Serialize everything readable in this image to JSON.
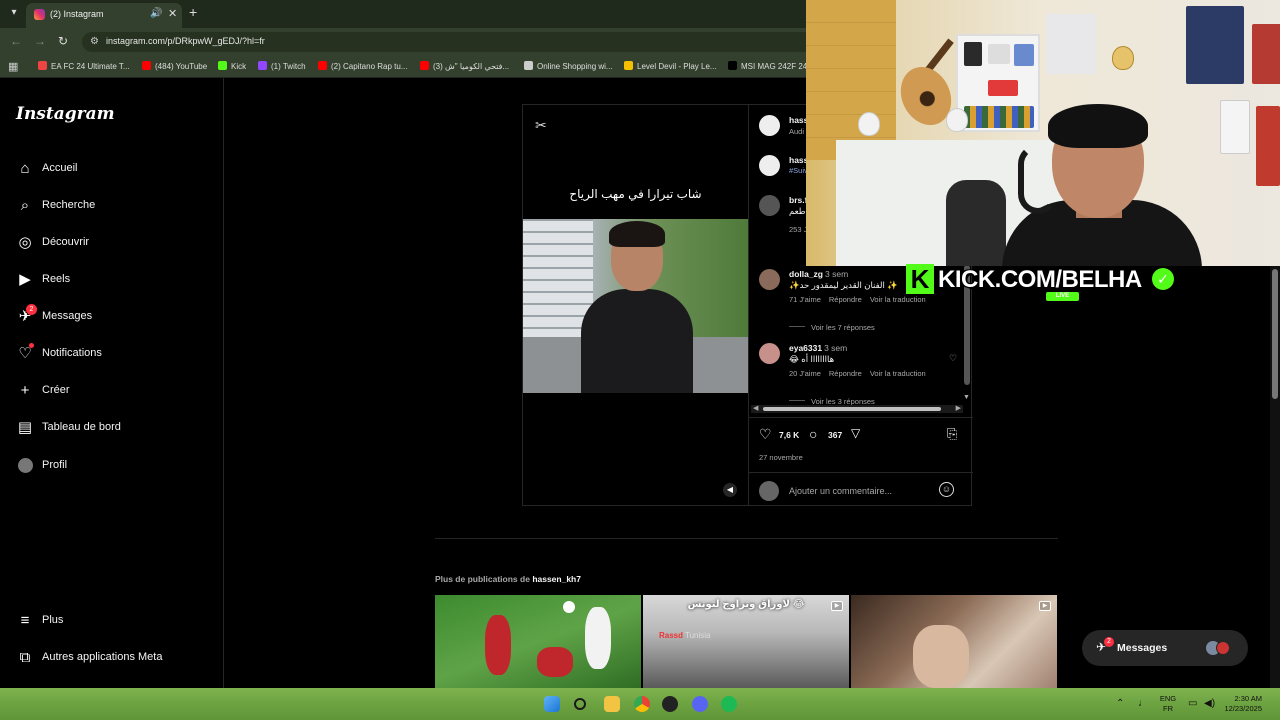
{
  "browser": {
    "tab_title": "(2) Instagram",
    "url": "instagram.com/p/DRkpwW_gEDJ/?hl=fr",
    "bookmarks": [
      {
        "label": "EA FC 24 Ultimate T...",
        "color": "#e44"
      },
      {
        "label": "(484) YouTube",
        "color": "#f00"
      },
      {
        "label": "Kick",
        "color": "#53fc18"
      },
      {
        "label": "(1) Twitch",
        "color": "#9146ff"
      },
      {
        "label": "(2) Capitano Rap tu...",
        "color": "#f00"
      },
      {
        "label": "(3) فتحي الكوميا \"ش...",
        "color": "#f00"
      },
      {
        "label": "Online Shopping wi...",
        "color": "#ccc"
      },
      {
        "label": "Level Devil - Play Le...",
        "color": "#f5c000"
      },
      {
        "label": "MSI MAG 242F 24",
        "color": "#000"
      }
    ]
  },
  "instagram": {
    "logo": "Instagram",
    "nav": [
      {
        "id": "home",
        "label": "Accueil",
        "icon": "house-icon"
      },
      {
        "id": "search",
        "label": "Recherche",
        "icon": "search-icon"
      },
      {
        "id": "explore",
        "label": "Découvrir",
        "icon": "compass-icon"
      },
      {
        "id": "reels",
        "label": "Reels",
        "icon": "reels-icon"
      },
      {
        "id": "messages",
        "label": "Messages",
        "icon": "messenger-icon",
        "badge": "2"
      },
      {
        "id": "notifications",
        "label": "Notifications",
        "icon": "heart-icon",
        "dot": true
      },
      {
        "id": "create",
        "label": "Créer",
        "icon": "plus-icon"
      },
      {
        "id": "dashboard",
        "label": "Tableau de bord",
        "icon": "chart-icon"
      },
      {
        "id": "profile",
        "label": "Profil",
        "icon": "avatar"
      }
    ],
    "more": "Plus",
    "meta_apps": "Autres applications Meta"
  },
  "post": {
    "video_caption": "شاب تيرارا في مهب الرياح",
    "side_header": [
      {
        "user": "hass",
        "sub": "Audi"
      },
      {
        "user": "hasse",
        "sub": "#Suiv"
      },
      {
        "user": "brs.f",
        "sub": "طعم"
      }
    ],
    "side_likes_partial": "253 J",
    "comments": [
      {
        "user": "dolla_zg",
        "time": "3 sem",
        "text": "✨الفنان القدير ليمقدور حد ✨",
        "likes": "71 J'aime",
        "reply": "Répondre",
        "translate": "Voir la traduction",
        "replies": "Voir les 7 réponses"
      },
      {
        "user": "eya6331",
        "time": "3 sem",
        "text": "😂 هاااااااا أه",
        "likes": "20 J'aime",
        "reply": "Répondre",
        "translate": "Voir la traduction",
        "replies": "Voir les 3 réponses"
      }
    ],
    "likes": "7,6 K",
    "comments_count": "367",
    "date": "27 novembre",
    "add_comment_placeholder": "Ajouter un commentaire..."
  },
  "more_posts": {
    "prefix": "Plus de publications de",
    "user": "hassen_kh7",
    "tiles": [
      {
        "text": ""
      },
      {
        "text": "لاوراق وتزاوج لتونس 😂",
        "source": "Rassd",
        "source_sub": "Tunisia"
      },
      {
        "text": ""
      }
    ]
  },
  "messages_pill": {
    "label": "Messages",
    "badge": "2"
  },
  "overlay": {
    "kick_text": "KICK.COM/BELHA",
    "live": "LIVE"
  },
  "taskbar": {
    "lang_top": "ENG",
    "lang_bottom": "FR",
    "time": "2:30 AM",
    "date": "12/23/2025"
  },
  "colors": {
    "instagram_bg": "#000000",
    "kick_green": "#53fc18",
    "notification_red": "#ff3040",
    "taskbar_green": "#6aa03f"
  }
}
